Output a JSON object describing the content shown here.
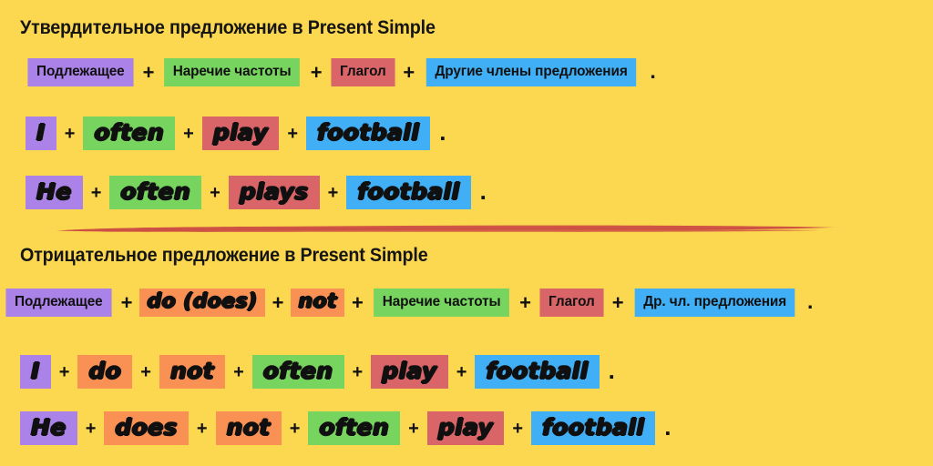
{
  "background_color": "#fcd850",
  "palette": {
    "purple": "#ab82e8",
    "green": "#77d45f",
    "red": "#da6569",
    "blue": "#40aff5",
    "orange": "#fa9154",
    "brush_red": "#cc5043",
    "text": "#101010"
  },
  "sections": {
    "affirmative": {
      "title": "Утвердительное предложение в Present Simple",
      "formula": {
        "tiles": [
          "Подлежащее",
          "Наречие частоты",
          "Глагол",
          "Другие члены предложения"
        ],
        "separator": "+",
        "period": "."
      },
      "examples": [
        {
          "tiles": [
            "I",
            "often",
            "play",
            "football"
          ],
          "separator": "+",
          "period": "."
        },
        {
          "tiles": [
            "He",
            "often",
            "plays",
            "football"
          ],
          "separator": "+",
          "period": "."
        }
      ]
    },
    "negative": {
      "title": "Отрицательное предложение в Present Simple",
      "formula": {
        "tiles": [
          "Подлежащее",
          "do (does)",
          "not",
          "Наречие частоты",
          "Глагол",
          "Др. чл. предложения"
        ],
        "separator": "+",
        "period": "."
      },
      "examples": [
        {
          "tiles": [
            "I",
            "do",
            "not",
            "often",
            "play",
            "football"
          ],
          "separator": "+",
          "period": "."
        },
        {
          "tiles": [
            "He",
            "does",
            "not",
            "often",
            "play",
            "football"
          ],
          "separator": "+",
          "period": "."
        }
      ]
    }
  }
}
